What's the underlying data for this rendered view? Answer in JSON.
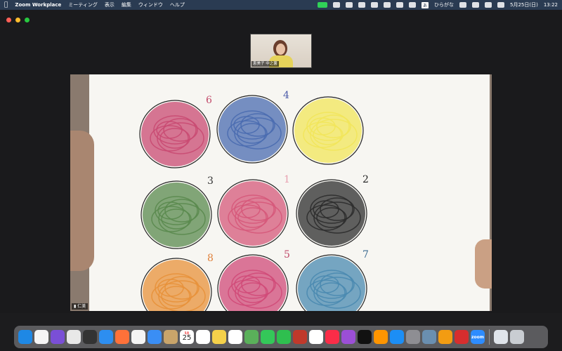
{
  "menubar": {
    "app_name": "Zoom Workplace",
    "menus": [
      "ミーティング",
      "表示",
      "編集",
      "ウィンドウ",
      "ヘルプ"
    ],
    "ime_badge": "あ",
    "ime_label": "ひらがな",
    "date": "5月25日(日)",
    "time": "13:22"
  },
  "meeting": {
    "thumbnail_name": "恵美子 中之薗",
    "main_name": "仁美"
  },
  "drawing": {
    "circles": [
      {
        "number": "6",
        "color": "#c94a72",
        "number_color": "#c24a6a"
      },
      {
        "number": "4",
        "color": "#4a6bb0",
        "number_color": "#4a5aa8"
      },
      {
        "number": "",
        "color": "#f2e65a",
        "number_color": "#e6c84a"
      },
      {
        "number": "3",
        "color": "#5a8a4e",
        "number_color": "#333333"
      },
      {
        "number": "1",
        "color": "#d6587a",
        "number_color": "#e8a0b0"
      },
      {
        "number": "2",
        "color": "#2c2c2c",
        "number_color": "#222222"
      },
      {
        "number": "8",
        "color": "#e8913a",
        "number_color": "#e0803a"
      },
      {
        "number": "5",
        "color": "#d04a78",
        "number_color": "#c04a6a"
      },
      {
        "number": "7",
        "color": "#4a8ab0",
        "number_color": "#3a6a90"
      }
    ]
  },
  "dock": {
    "calendar_month": "5月",
    "calendar_day": "25",
    "zoom_label": "zoom",
    "apps": [
      {
        "name": "finder-icon",
        "color": "#1e88e5"
      },
      {
        "name": "textedit-icon",
        "color": "#f5f5f5"
      },
      {
        "name": "siri-icon",
        "color": "#7a4fd6"
      },
      {
        "name": "launchpad-icon",
        "color": "#e8e8e8"
      },
      {
        "name": "mission-control-icon",
        "color": "#333333"
      },
      {
        "name": "safari-icon",
        "color": "#2d8ef0"
      },
      {
        "name": "firefox-icon",
        "color": "#ff7139"
      },
      {
        "name": "chrome-icon",
        "color": "#f4f4f4"
      },
      {
        "name": "mail-icon",
        "color": "#3a8ef5"
      },
      {
        "name": "contacts-icon",
        "color": "#c9a46a"
      },
      {
        "name": "calendar-icon",
        "color": "#ffffff"
      },
      {
        "name": "reminders-icon",
        "color": "#ffffff"
      },
      {
        "name": "notes-icon",
        "color": "#f5d14a"
      },
      {
        "name": "freeform-icon",
        "color": "#ffffff"
      },
      {
        "name": "maps-icon",
        "color": "#5ab05a"
      },
      {
        "name": "messages-icon",
        "color": "#34c759"
      },
      {
        "name": "facetime-icon",
        "color": "#2fbf4f"
      },
      {
        "name": "photo-booth-icon",
        "color": "#c0392b"
      },
      {
        "name": "photos-icon",
        "color": "#ffffff"
      },
      {
        "name": "music-icon",
        "color": "#fa2d48"
      },
      {
        "name": "podcasts-icon",
        "color": "#9b4fd6"
      },
      {
        "name": "tv-icon",
        "color": "#111111"
      },
      {
        "name": "books-icon",
        "color": "#ff9500"
      },
      {
        "name": "app-store-icon",
        "color": "#1c8ef5"
      },
      {
        "name": "system-settings-icon",
        "color": "#8e8e93"
      },
      {
        "name": "preview-icon",
        "color": "#6a8fb0"
      },
      {
        "name": "pages-icon",
        "color": "#f39c12"
      },
      {
        "name": "acrobat-icon",
        "color": "#d62e2e"
      },
      {
        "name": "zoom-icon",
        "color": "#2d8cff"
      },
      {
        "name": "downloads-icon",
        "color": "#dfe4ea"
      },
      {
        "name": "trash-icon",
        "color": "#c9cdd2"
      }
    ]
  }
}
